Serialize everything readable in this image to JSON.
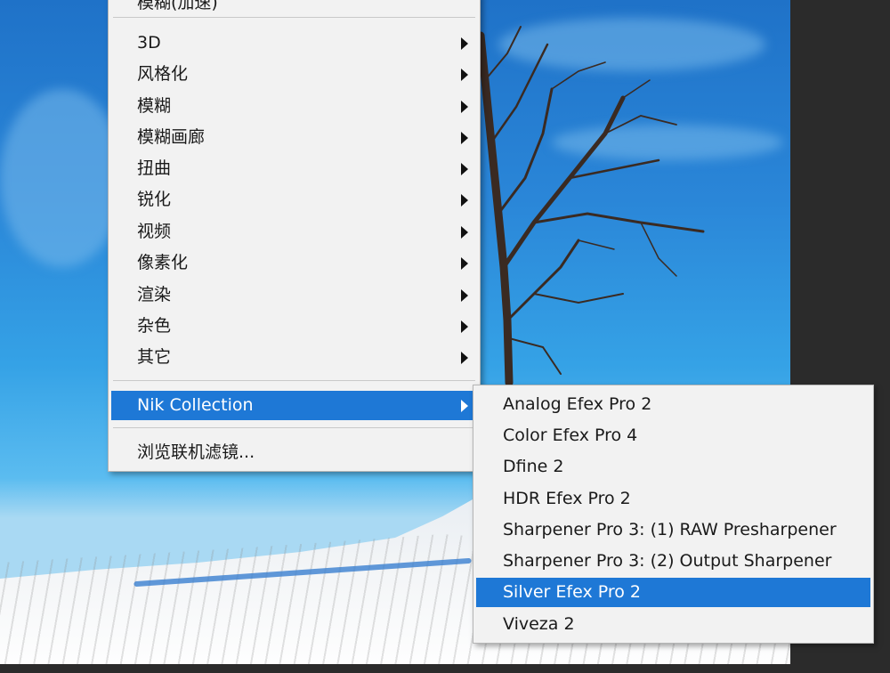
{
  "main_menu": {
    "partial_item_top": "模糊(加速)",
    "items": [
      {
        "label": "3D",
        "has_submenu": true
      },
      {
        "label": "风格化",
        "has_submenu": true
      },
      {
        "label": "模糊",
        "has_submenu": true
      },
      {
        "label": "模糊画廊",
        "has_submenu": true
      },
      {
        "label": "扭曲",
        "has_submenu": true
      },
      {
        "label": "锐化",
        "has_submenu": true
      },
      {
        "label": "视频",
        "has_submenu": true
      },
      {
        "label": "像素化",
        "has_submenu": true
      },
      {
        "label": "渲染",
        "has_submenu": true
      },
      {
        "label": "杂色",
        "has_submenu": true
      },
      {
        "label": "其它",
        "has_submenu": true
      }
    ],
    "nik_item": {
      "label": "Nik Collection",
      "highlighted": true
    },
    "browse_item": {
      "label": "浏览联机滤镜..."
    }
  },
  "sub_menu": {
    "items": [
      {
        "label": "Analog Efex Pro 2"
      },
      {
        "label": "Color Efex Pro 4"
      },
      {
        "label": "Dfine 2"
      },
      {
        "label": "HDR Efex Pro 2"
      },
      {
        "label": "Sharpener Pro 3: (1) RAW Presharpener"
      },
      {
        "label": "Sharpener Pro 3: (2) Output Sharpener"
      },
      {
        "label": "Silver Efex Pro 2",
        "highlighted": true
      },
      {
        "label": "Viveza 2"
      }
    ]
  },
  "colors": {
    "highlight": "#1e78d6",
    "menu_bg": "#f2f2f2",
    "workspace": "#2b2b2b"
  }
}
